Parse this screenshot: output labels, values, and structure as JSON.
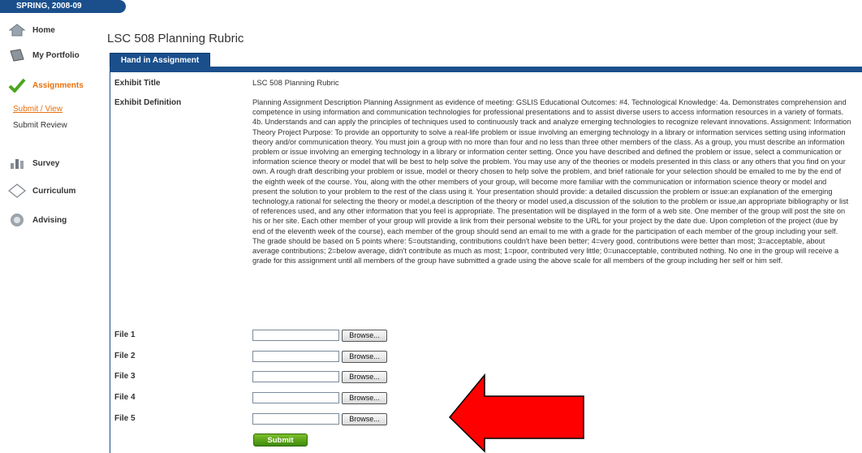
{
  "term": "SPRING, 2008-09",
  "sidebar": {
    "items": [
      {
        "label": "Home",
        "icon": "home-icon"
      },
      {
        "label": "My Portfolio",
        "icon": "portfolio-icon"
      },
      {
        "label": "Assignments",
        "icon": "checkmark-icon"
      },
      {
        "label": "Survey",
        "icon": "survey-icon"
      },
      {
        "label": "Curriculum",
        "icon": "curriculum-icon"
      },
      {
        "label": "Advising",
        "icon": "advising-icon"
      }
    ],
    "subitems": [
      "Submit / View",
      "Submit Review"
    ]
  },
  "main": {
    "title": "LSC 508 Planning Rubric",
    "tab": "Hand in Assignment",
    "exhibit_title_label": "Exhibit Title",
    "exhibit_title_value": "LSC 508 Planning Rubric",
    "exhibit_definition_label": "Exhibit Definition",
    "exhibit_definition": "Planning Assignment Description Planning Assignment as evidence of meeting: GSLIS Educational Outcomes: #4. Technological Knowledge: 4a. Demonstrates comprehension and competence in using information and communication technologies for professional presentations and to assist diverse users to access information resources in a variety of formats. 4b. Understands and can apply the principles of techniques used to continuously track and analyze emerging technologies to recognize relevant innovations. Assignment: Information Theory Project Purpose: To provide an opportunity to solve a real-life problem or issue involving an emerging technology in a library or information services setting using information theory and/or communication theory. You must join a group with no more than four and no less than three other members of the class. As a group, you must describe an information problem or issue involving an emerging technology in a library or information center setting. Once you have described and defined the problem or issue, select a communication or information science theory or model that will be best to help solve the problem. You may use any of the theories or models presented in this class or any others that you find on your own. A rough draft describing your problem or issue, model or theory chosen to help solve the problem, and brief rationale for your selection should be emailed to me by the end of the eighth week of the course. You, along with the other members of your group, will become more familiar with the communication or information science theory or model and present the solution to your problem to the rest of the class using it. Your presentation should provide: a detailed discussion the problem or issue:an explanation of the emerging technology,a rational for selecting the theory or model,a description of the theory or model used,a discussion of the solution to the problem or issue,an appropriate bibliography or list of references used, and any other information that you feel is appropriate. The presentation will be displayed in the form of a web site. One member of the group will post the site on his or her site. Each other member of your group will provide a link from their personal website to the URL for your project by the date due. Upon completion of the project (due by end of the eleventh week of the course), each member of the group should send an email to me with a grade for the participation of each member of the group including your self. The grade should be based on 5 points where: 5=outstanding, contributions couldn't have been better; 4=very good, contributions were better than most; 3=acceptable, about average contributions; 2=below average, didn't contribute as much as most; 1=poor, contributed very little; 0=unacceptable, contributed nothing. No one in the group will receive a grade for this assignment until all members of the group have submitted a grade using the above scale for all members of the group including her self or him self.",
    "files": [
      {
        "label": "File 1",
        "browse": "Browse..."
      },
      {
        "label": "File 2",
        "browse": "Browse..."
      },
      {
        "label": "File 3",
        "browse": "Browse..."
      },
      {
        "label": "File 4",
        "browse": "Browse..."
      },
      {
        "label": "File 5",
        "browse": "Browse..."
      }
    ],
    "submit": "Submit"
  },
  "colors": {
    "brand_blue": "#1a4f8c",
    "active_orange": "#e8700c",
    "submit_green": "#4f9a14",
    "arrow_red": "#ff0000"
  }
}
